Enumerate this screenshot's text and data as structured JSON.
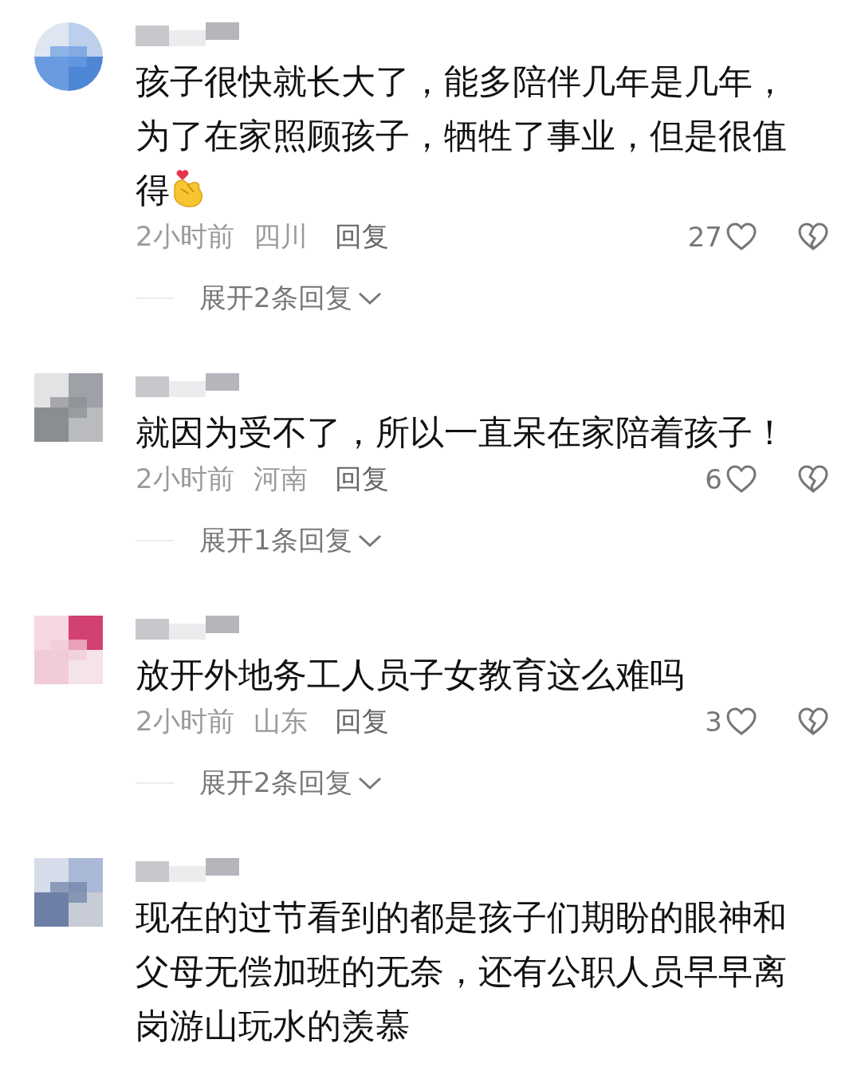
{
  "comments": [
    {
      "text": "孩子很快就长大了，能多陪伴几年是几年，为了在家照顾孩子，牺牲了事业，但是很值得",
      "time": "2小时前",
      "location": "四川",
      "reply": "回复",
      "likes": "27",
      "expand": "展开2条回复"
    },
    {
      "text": "就因为受不了，所以一直呆在家陪着孩子！",
      "time": "2小时前",
      "location": "河南",
      "reply": "回复",
      "likes": "6",
      "expand": "展开1条回复"
    },
    {
      "text": "放开外地务工人员子女教育这么难吗",
      "time": "2小时前",
      "location": "山东",
      "reply": "回复",
      "likes": "3",
      "expand": "展开2条回复"
    },
    {
      "text": "现在的过节看到的都是孩子们期盼的眼神和父母无偿加班的无奈，还有公职人员早早离岗游山玩水的羡慕"
    }
  ]
}
